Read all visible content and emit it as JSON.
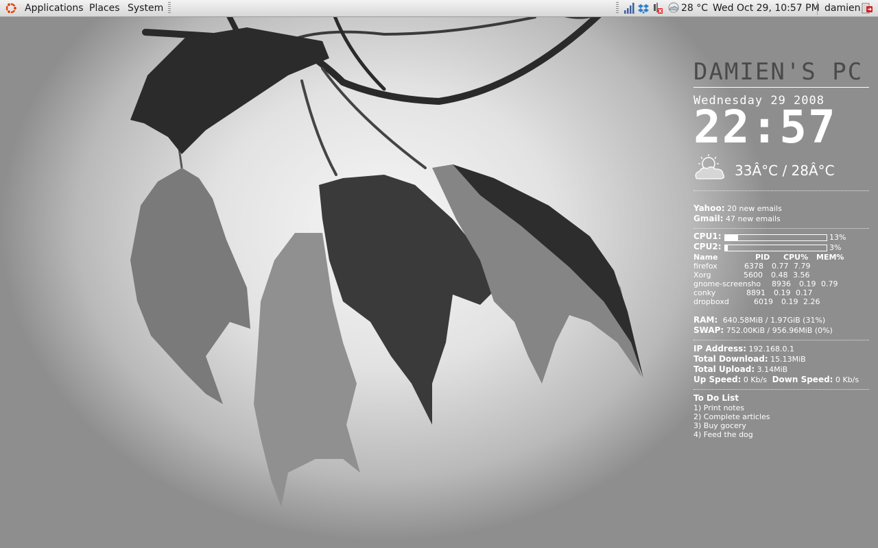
{
  "panel": {
    "menus": [
      "Applications",
      "Places",
      "System"
    ],
    "weather_temp": "28 °C",
    "datetime": "Wed Oct 29, 10:57 PM",
    "user": "damien",
    "tray_icons": [
      "network-signal-icon",
      "dropbox-icon",
      "volume-muted-icon",
      "weather-cloud-icon"
    ]
  },
  "conky": {
    "title": "DAMIEN'S PC",
    "date": "Wednesday 29 2008",
    "time": "22:57",
    "weather": {
      "icon": "partly-cloudy-icon",
      "temps": "33Â°C / 28Â°C"
    },
    "email": [
      {
        "label": "Yahoo:",
        "value": "20 new emails"
      },
      {
        "label": "Gmail:",
        "value": "47 new emails"
      }
    ],
    "cpus": [
      {
        "label": "CPU1:",
        "percent": 13,
        "percent_text": "13%"
      },
      {
        "label": "CPU2:",
        "percent": 3,
        "percent_text": "3%"
      }
    ],
    "process_headers": [
      "Name",
      "PID",
      "CPU%",
      "MEM%"
    ],
    "processes": [
      {
        "name": "firefox",
        "pid": "6378",
        "cpu": "0.77",
        "mem": "7.79"
      },
      {
        "name": "Xorg",
        "pid": "5600",
        "cpu": "0.48",
        "mem": "3.56"
      },
      {
        "name": "gnome-screensho",
        "pid": "8936",
        "cpu": "0.19",
        "mem": "0.79"
      },
      {
        "name": "conky",
        "pid": "8891",
        "cpu": "0.19",
        "mem": "0.17"
      },
      {
        "name": "dropboxd",
        "pid": "6019",
        "cpu": "0.19",
        "mem": "2.26"
      }
    ],
    "memory": {
      "ram_label": "RAM:",
      "ram_value": "640.58MiB / 1.97GiB (31%)",
      "swap_label": "SWAP:",
      "swap_value": "752.00KiB / 956.96MiB (0%)"
    },
    "network": {
      "ip_label": "IP Address:",
      "ip": "192.168.0.1",
      "down_total_label": "Total Download:",
      "down_total": "15.13MiB",
      "up_total_label": "Total Upload:",
      "up_total": "3.14MiB",
      "up_speed_label": "Up Speed:",
      "up_speed": "0 Kb/s",
      "down_speed_label": "Down Speed:",
      "down_speed": "0 Kb/s"
    },
    "todo": {
      "title": "To Do List",
      "items": [
        "1) Print notes",
        "2) Complete articles",
        "3) Buy gocery",
        "4) Feed the dog"
      ]
    }
  }
}
